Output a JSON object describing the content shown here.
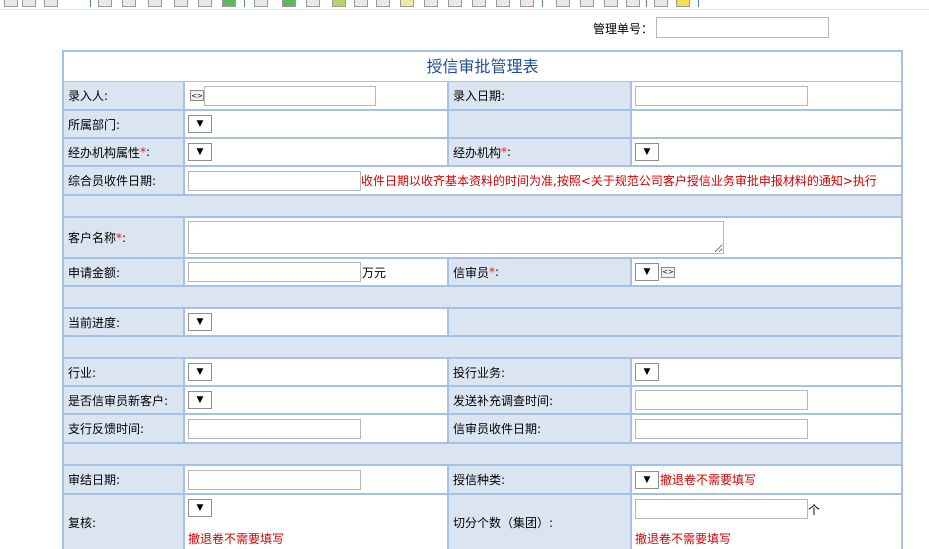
{
  "top": {
    "mgmt_no_label": "管理单号：",
    "mgmt_no_value": ""
  },
  "form": {
    "title": "授信审批管理表",
    "req_mark": "*",
    "rows": {
      "entry_person_label": "录入人:",
      "entry_date_label": "录入日期:",
      "dept_label": "所属部门:",
      "branch_type_label": "经办机构属性",
      "branch_label": "经办机构",
      "colon": ":",
      "receipt_date_label": "综合员收件日期:",
      "receipt_date_note": "收件日期以收齐基本资料的时间为准,按照<关于规范公司客户授信业务审批申报材料的通知>执行",
      "customer_name_label": "客户名称",
      "amount_label": "申请金额:",
      "amount_unit": "万元",
      "reviewer_label": "信审员",
      "progress_label": "当前进度:",
      "industry_label": "行业:",
      "investbank_label": "投行业务:",
      "new_customer_label": "是否信审员新客户:",
      "supplement_label": "发送补充调查时间:",
      "feedback_label": "支行反馈时间:",
      "reviewer_receipt_label": "信审员收件日期:",
      "conclude_date_label": "审结日期:",
      "credit_type_label": "授信种类:",
      "credit_type_note": "撤退卷不需要填写",
      "recheck_label": "复核:",
      "recheck_note": "撤退卷不需要填写",
      "split_count_label": "切分个数（集团）:",
      "split_unit": "个",
      "split_note": "撤退卷不需要填写"
    },
    "dropdown_glyph": "▼"
  }
}
